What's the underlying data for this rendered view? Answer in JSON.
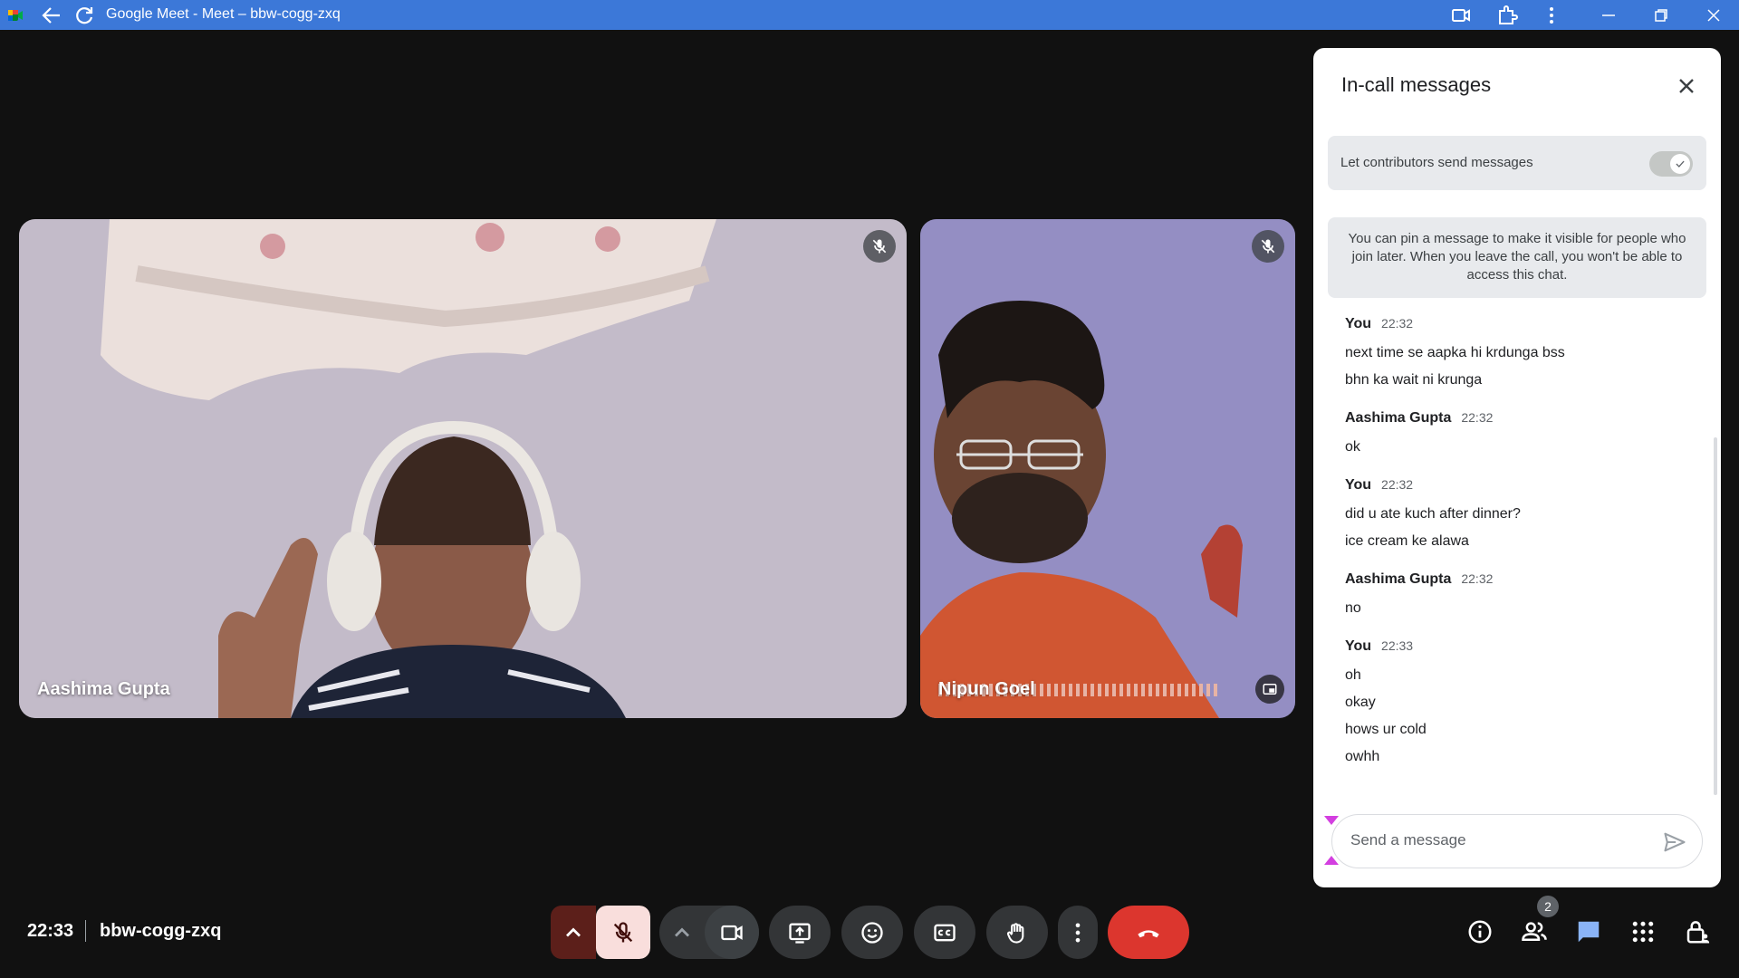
{
  "window": {
    "title": "Google Meet - Meet – bbw-cogg-zxq"
  },
  "tiles": [
    {
      "name": "Aashima Gupta",
      "muted": true
    },
    {
      "name": "Nipun Goel",
      "muted": true
    }
  ],
  "chat": {
    "title": "In-call messages",
    "toggle_label": "Let contributors send messages",
    "toggle_on": true,
    "info": "You can pin a message to make it visible for people who join later. When you leave the call, you won't be able to access this chat.",
    "messages": [
      {
        "sender": "You",
        "time": "22:32",
        "lines": [
          "next time se aapka hi krdunga bss",
          "bhn ka wait ni krunga"
        ]
      },
      {
        "sender": "Aashima Gupta",
        "time": "22:32",
        "lines": [
          "ok"
        ]
      },
      {
        "sender": "You",
        "time": "22:32",
        "lines": [
          "did u ate kuch after dinner?",
          "ice cream ke alawa"
        ]
      },
      {
        "sender": "Aashima Gupta",
        "time": "22:32",
        "lines": [
          "no"
        ]
      },
      {
        "sender": "You",
        "time": "22:33",
        "lines": [
          "oh",
          "okay",
          "hows ur cold",
          "owhh"
        ]
      }
    ],
    "input_placeholder": "Send a message"
  },
  "bottom": {
    "time": "22:33",
    "meeting_code": "bbw-cogg-zxq",
    "participants_count": "2"
  },
  "colors": {
    "titlebar": "#3c78d8",
    "end_call": "#dc362e",
    "chat_accent": "#1a73e8"
  }
}
